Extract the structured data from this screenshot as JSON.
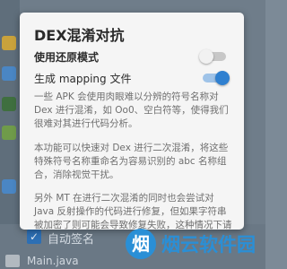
{
  "dialog": {
    "title": "DEX混淆对抗",
    "options": [
      {
        "label": "使用还原模式",
        "enabled": false
      },
      {
        "label": "生成 mapping 文件",
        "enabled": true
      }
    ],
    "paragraphs": [
      "一些 APK 会使用肉眼难以分辨的符号名称对 Dex 进行混淆，如 Oo0、空白符等，使得我们很难对其进行代码分析。",
      "本功能可以快速对 Dex 进行二次混淆，将这些特殊符号名称重命名为容易识别的 abc 名称组合，消除视觉干扰。",
      "另外 MT 在进行二次混淆的同时也会尝试对 Java 反射操作的代码进行修复，但如果字符串被加密了则可能会导致修复失败，这种情况下请先进行字符串解密，或者在安装运行前使用还原模式处理。"
    ]
  },
  "background": {
    "checkbox_label": "自动签名",
    "file_name": "Main.java",
    "checkbox_checked": true
  },
  "watermark": {
    "text": "烟云软件园",
    "logo_glyph": "烟"
  },
  "colors": {
    "accent": "#2f80d0",
    "watermark": "#2a8fd6"
  }
}
